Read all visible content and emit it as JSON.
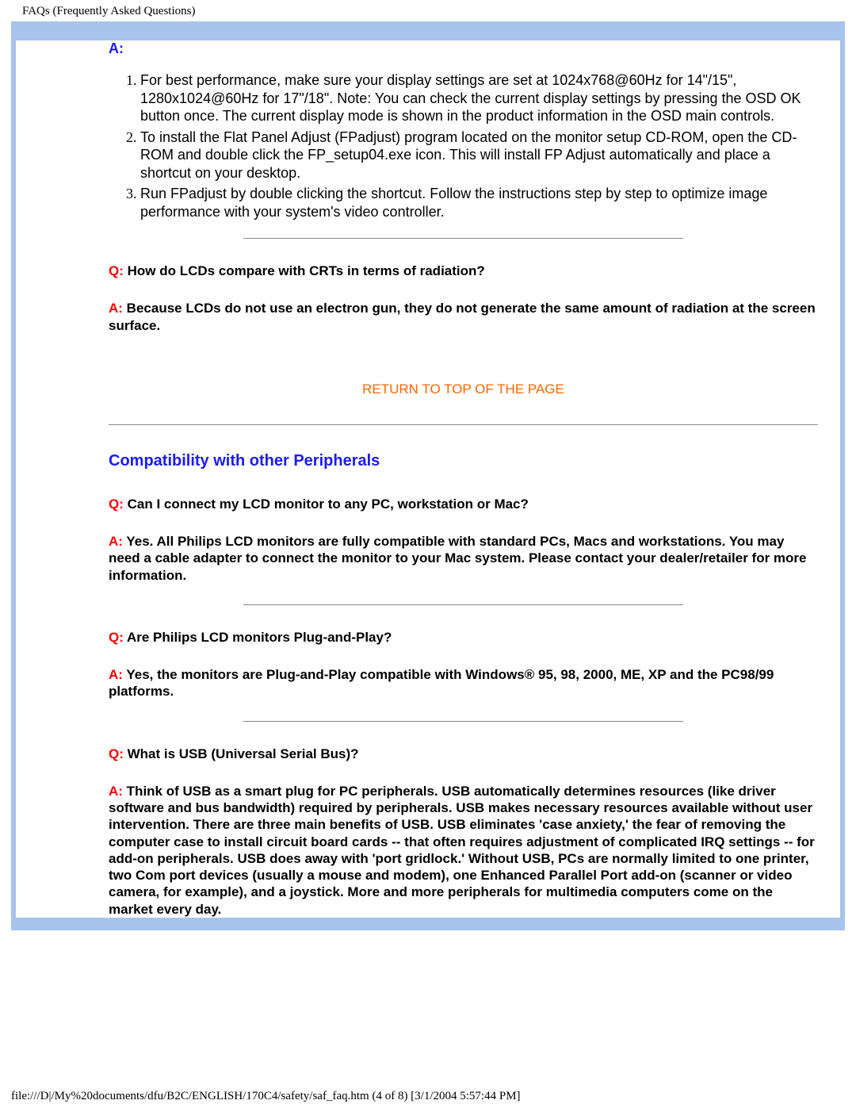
{
  "crumb": "FAQs (Frequently Asked Questions)",
  "top_answer_label": "A:",
  "steps": [
    "For best performance, make sure your display settings are set at 1024x768@60Hz for 14\"/15\", 1280x1024@60Hz for 17\"/18\". Note: You can check the current display settings by pressing the OSD OK button once.\nThe current display mode is shown in the product information in the OSD main controls.",
    "To install the Flat Panel Adjust (FPadjust) program located on the monitor setup CD-ROM, open the CD-ROM and double click the FP_setup04.exe icon. This will install FP Adjust automatically and place a shortcut on your desktop.",
    "Run FPadjust by double clicking the shortcut. Follow the instructions step by step to optimize image performance with your system's video controller."
  ],
  "qa1": {
    "q_label": "Q:",
    "q": " How do LCDs compare with CRTs in terms of radiation?",
    "a_label": "A:",
    "a": " Because LCDs do not use an electron gun, they do not generate the same amount of radiation at the screen surface."
  },
  "return_link": "RETURN TO TOP OF THE PAGE",
  "section_heading": "Compatibility with other Peripherals",
  "qa2": {
    "q_label": "Q:",
    "q": " Can I connect my LCD monitor to any PC, workstation or Mac?",
    "a_label": "A:",
    "a": " Yes. All Philips LCD monitors are fully compatible with standard PCs, Macs and workstations. You may need a cable adapter to connect the monitor to your Mac system. Please contact your dealer/retailer for more information."
  },
  "qa3": {
    "q_label": "Q:",
    "q": " Are Philips LCD monitors Plug-and-Play?",
    "a_label": "A:",
    "a": " Yes, the monitors are Plug-and-Play compatible with Windows® 95, 98, 2000, ME, XP and the PC98/99 platforms."
  },
  "qa4": {
    "q_label": "Q:",
    "q": " What is USB (Universal Serial Bus)?",
    "a_label": "A:",
    "a": " Think of USB as a smart plug for PC peripherals. USB automatically determines resources (like driver software and bus bandwidth) required by peripherals. USB makes necessary resources available without user intervention. There are three main benefits of USB. USB eliminates 'case anxiety,' the fear of removing the computer case to install circuit board cards -- that often requires adjustment of complicated IRQ settings -- for add-on peripherals. USB does away with 'port gridlock.' Without USB, PCs are normally limited to one printer, two Com port devices (usually a mouse and modem), one Enhanced Parallel Port add-on (scanner or video camera, for example), and a joystick. More and more peripherals for multimedia computers come on the market every day."
  },
  "footer": "file:///D|/My%20documents/dfu/B2C/ENGLISH/170C4/safety/saf_faq.htm (4 of 8) [3/1/2004 5:57:44 PM]"
}
